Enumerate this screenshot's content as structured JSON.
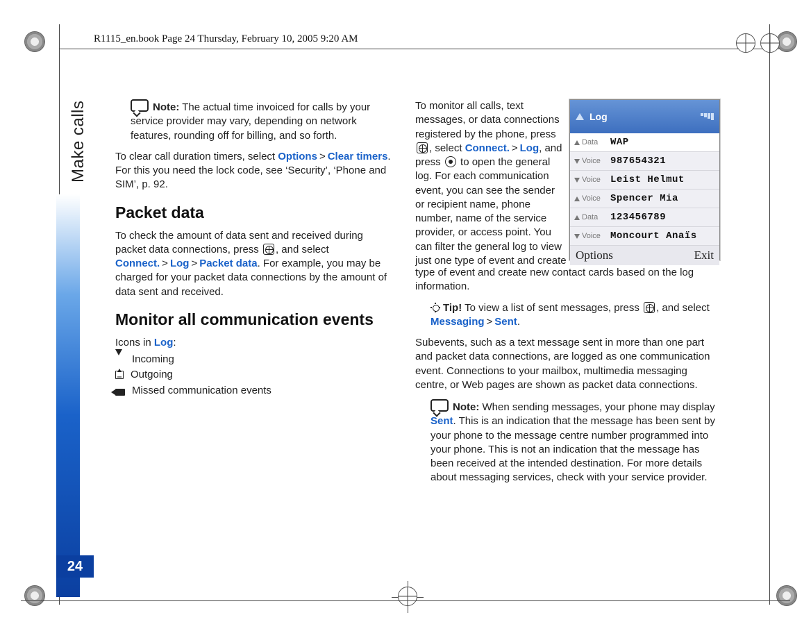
{
  "header": {
    "text": "R1115_en.book  Page 24  Thursday, February 10, 2005  9:20 AM"
  },
  "side_label": "Make calls",
  "page_number": "24",
  "left": {
    "note1_label": "Note:",
    "note1_text": " The actual time invoiced for calls by your service provider may vary, depending on network features, rounding off for billing, and so forth.",
    "clear_pre": "To clear call duration timers, select ",
    "options": "Options",
    "clear_timers": "Clear timers",
    "clear_post": ". For this you need the lock code, see ‘Security’, ‘Phone and SIM’, p. 92.",
    "h_packet": "Packet data",
    "packet_pre": "To check the amount of data sent and received during packet data connections, press ",
    "packet_mid": ", and select ",
    "connect": "Connect.",
    "log": "Log",
    "packet_data": "Packet data",
    "packet_post": ". For example, you may be charged for your packet data connections by the amount of data sent and received.",
    "h_monitor": "Monitor all communication events",
    "icons_in": "Icons in ",
    "log2": "Log",
    "colon": ":",
    "incoming": "Incoming",
    "outgoing": "Outgoing",
    "missed": "Missed communication events"
  },
  "right": {
    "monitor_pre": "To monitor all calls, text messages, or data connections registered by the phone, press ",
    "monitor_mid1": ", select ",
    "connect": "Connect.",
    "log": "Log",
    "monitor_mid2": ", and press ",
    "monitor_post": " to open the general log. For each communication event, you can see the sender or recipient name, phone number, name of the service provider, or access point. You can filter the general log to view just one type of event and create new contact cards based on the log information.",
    "tip_label": "Tip!",
    "tip_pre": " To view a list of sent messages, press ",
    "tip_mid": ", and select ",
    "messaging": "Messaging",
    "sent": "Sent",
    "tip_post": ".",
    "subevents": "Subevents, such as a text message sent in more than one part and packet data connections, are logged as one communication event. Connections to your mailbox, multimedia messaging centre, or Web pages are shown as packet data connections.",
    "note2_label": "Note:",
    "note2_pre": " When sending messages, your phone may display ",
    "note2_sent": "Sent",
    "note2_post": ". This is an indication that the message has been sent by your phone to the message centre number programmed into your phone. This is not an indication that the message has been received at the intended destination. For more details about messaging services, check with your service provider."
  },
  "phone": {
    "title": "Log",
    "rows": [
      {
        "tag": "Data",
        "dir": "up",
        "val": "WAP",
        "sel": true
      },
      {
        "tag": "Voice",
        "dir": "down",
        "val": "987654321"
      },
      {
        "tag": "Voice",
        "dir": "down",
        "val": "Leist Helmut"
      },
      {
        "tag": "Voice",
        "dir": "up",
        "val": "Spencer Mia"
      },
      {
        "tag": "Data",
        "dir": "up",
        "val": "123456789"
      },
      {
        "tag": "Voice",
        "dir": "down",
        "val": "Moncourt Anaïs"
      }
    ],
    "left_soft": "Options",
    "right_soft": "Exit"
  }
}
